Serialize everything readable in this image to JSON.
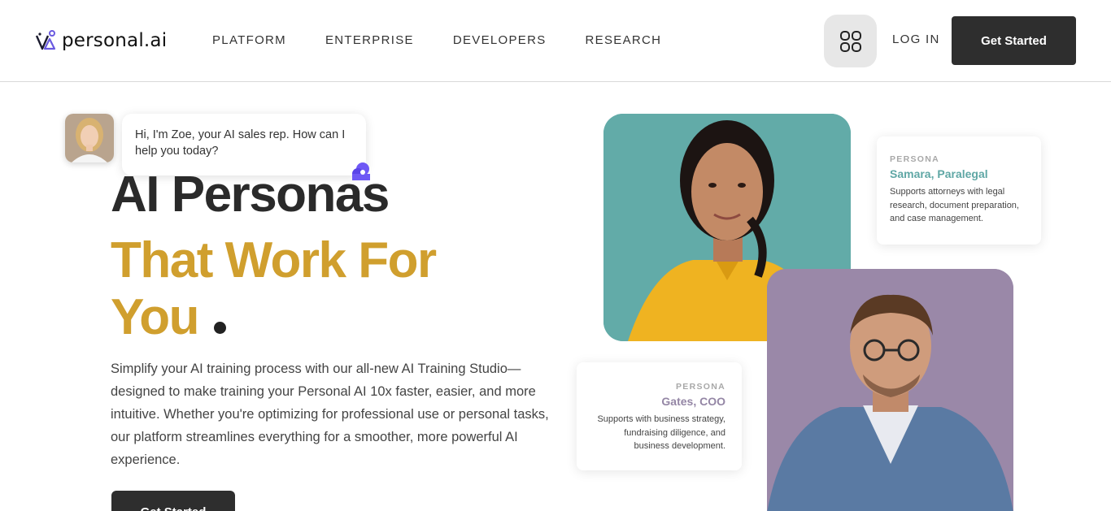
{
  "header": {
    "logo_text": "personal.ai",
    "nav": [
      "PLATFORM",
      "ENTERPRISE",
      "DEVELOPERS",
      "RESEARCH"
    ],
    "menu_icon": "grid-icon",
    "login_label": "LOG IN",
    "cta_label": "Get Started"
  },
  "chat": {
    "message": "Hi, I'm Zoe, your AI sales rep. How can I help you today?",
    "avatar_icon": "avatar-zoe",
    "badge_icon": "chat-logo-icon"
  },
  "hero": {
    "title": "AI Personas",
    "subtitle": "That Work For You",
    "description": "Simplify your AI training process with our all-new AI Training Studio—designed to make training your Personal AI 10x faster, easier, and more intuitive. Whether you're optimizing for professional use or personal tasks, our platform streamlines everything for a smoother, more powerful AI experience.",
    "cta_label": "Get Started"
  },
  "personas": [
    {
      "label": "PERSONA",
      "name": "Samara, Paralegal",
      "description": "Supports attorneys with legal research, document preparation, and case management."
    },
    {
      "label": "PERSONA",
      "name": "Gates, COO",
      "description": "Supports with business strategy, fundraising diligence, and business development."
    }
  ],
  "colors": {
    "accent_gold": "#d09f2e",
    "dark_button": "#2e2e2e",
    "teal": "#62aba8",
    "lavender": "#9a88a8"
  }
}
